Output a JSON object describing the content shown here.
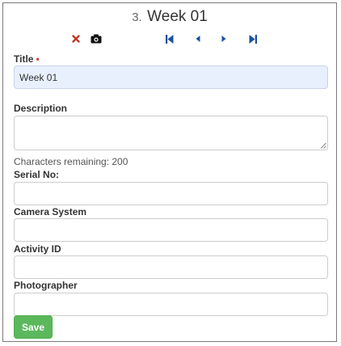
{
  "header": {
    "number": "3.",
    "title": "Week 01"
  },
  "toolbar": {
    "delete_icon": "close-icon",
    "camera_icon": "camera-icon",
    "first_icon": "skip-first-icon",
    "prev_icon": "triangle-left-icon",
    "next_icon": "triangle-right-icon",
    "last_icon": "skip-last-icon",
    "nav_color": "#1a4fa0",
    "delete_color": "#c0392b"
  },
  "form": {
    "title": {
      "label": "Title",
      "required_mark": "•",
      "value": "Week 01"
    },
    "description": {
      "label": "Description",
      "value": "",
      "hint": "Characters remaining: 200"
    },
    "serial_no": {
      "label": "Serial No:",
      "value": ""
    },
    "camera_system": {
      "label": "Camera System",
      "value": ""
    },
    "activity_id": {
      "label": "Activity ID",
      "value": ""
    },
    "photographer": {
      "label": "Photographer",
      "value": ""
    },
    "save_label": "Save"
  },
  "colors": {
    "accent_green": "#5cb85c",
    "filled_field": "#e8f0fe",
    "required": "#d43f3a"
  }
}
